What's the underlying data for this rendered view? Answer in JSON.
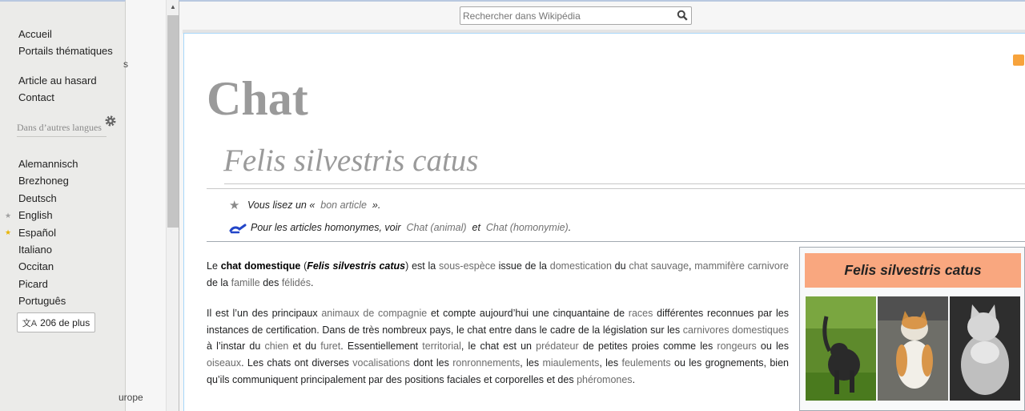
{
  "sidebar": {
    "nav": [
      {
        "label": "Accueil"
      },
      {
        "label": "Portails thématiques"
      },
      {
        "label": "Article au hasard"
      },
      {
        "label": "Contact"
      }
    ],
    "languages_heading": "Dans d’autres langues",
    "languages": [
      {
        "label": "Alemannisch",
        "mark": ""
      },
      {
        "label": "Brezhoneg",
        "mark": ""
      },
      {
        "label": "Deutsch",
        "mark": ""
      },
      {
        "label": "English",
        "mark": "good"
      },
      {
        "label": "Español",
        "mark": "featured"
      },
      {
        "label": "Italiano",
        "mark": ""
      },
      {
        "label": "Occitan",
        "mark": ""
      },
      {
        "label": "Picard",
        "mark": ""
      },
      {
        "label": "Português",
        "mark": ""
      }
    ],
    "more_languages": "206 de plus"
  },
  "background_fragments": {
    "frag1": "s",
    "frag2": "urope"
  },
  "search": {
    "placeholder": "Rechercher dans Wikipédia"
  },
  "article": {
    "title": "Chat",
    "subtitle": "Felis silvestris catus",
    "good_article": {
      "prefix": "Vous lisez un «",
      "link": "bon article",
      "suffix": "»."
    },
    "homonyms": {
      "prefix": "Pour les articles homonymes, voir",
      "link1": "Chat (animal)",
      "sep": "et",
      "link2": "Chat (homonymie)",
      "end": "."
    },
    "p1": [
      {
        "t": "Le "
      },
      {
        "t": "chat domestique",
        "s": "b"
      },
      {
        "t": " ("
      },
      {
        "t": "Felis silvestris catus",
        "s": "bi"
      },
      {
        "t": ") est la "
      },
      {
        "t": "sous-espèce",
        "s": "a"
      },
      {
        "t": " issue de la "
      },
      {
        "t": "domestication",
        "s": "a"
      },
      {
        "t": " du "
      },
      {
        "t": "chat sauvage",
        "s": "a"
      },
      {
        "t": ", "
      },
      {
        "t": "mammifère",
        "s": "a"
      },
      {
        "t": " "
      },
      {
        "t": "carnivore",
        "s": "a"
      },
      {
        "t": " de la "
      },
      {
        "t": "famille",
        "s": "a"
      },
      {
        "t": " des "
      },
      {
        "t": "félidés",
        "s": "a"
      },
      {
        "t": "."
      }
    ],
    "p2": [
      {
        "t": "Il est l’un des principaux "
      },
      {
        "t": "animaux de compagnie",
        "s": "a"
      },
      {
        "t": " et compte aujourd’hui une cinquantaine de "
      },
      {
        "t": "races",
        "s": "a"
      },
      {
        "t": " différentes reconnues par les instances de certification. Dans de très nombreux pays, le chat entre dans le cadre de la législation sur les "
      },
      {
        "t": "carnivores domestiques",
        "s": "a"
      },
      {
        "t": " à l’instar du "
      },
      {
        "t": "chien",
        "s": "a"
      },
      {
        "t": " et du "
      },
      {
        "t": "furet",
        "s": "a"
      },
      {
        "t": ". Essentiellement "
      },
      {
        "t": "territorial",
        "s": "a"
      },
      {
        "t": ", le chat est un "
      },
      {
        "t": "prédateur",
        "s": "a"
      },
      {
        "t": " de petites proies comme les "
      },
      {
        "t": "rongeurs",
        "s": "a"
      },
      {
        "t": " ou les "
      },
      {
        "t": "oiseaux",
        "s": "a"
      },
      {
        "t": ". Les chats ont diverses "
      },
      {
        "t": "vocalisations",
        "s": "a"
      },
      {
        "t": " dont les "
      },
      {
        "t": "ronronnements",
        "s": "a"
      },
      {
        "t": ", les "
      },
      {
        "t": "miaulements",
        "s": "a"
      },
      {
        "t": ", les "
      },
      {
        "t": "feulements",
        "s": "a"
      },
      {
        "t": " ou les grognements, bien qu’ils communiquent principalement par des positions faciales et corporelles et des "
      },
      {
        "t": "phéromones",
        "s": "a"
      },
      {
        "t": "."
      }
    ]
  },
  "infobox": {
    "title": "Felis silvestris catus"
  },
  "colors": {
    "link": "#6b6b6b",
    "infobox_header": "#f9a77f",
    "title_gray": "#9a9a9a"
  }
}
